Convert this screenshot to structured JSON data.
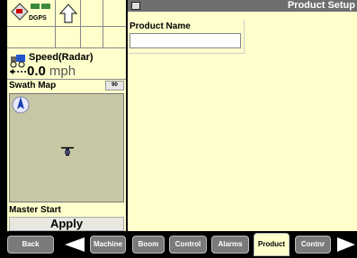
{
  "status": {
    "gps_label": "DGPS",
    "speed_label": "Speed(Radar)",
    "speed_value": "0.0",
    "speed_unit": "mph"
  },
  "swath": {
    "title": "Swath Map",
    "zoom_label": "90"
  },
  "master": {
    "label": "Master Start",
    "apply_label": "Apply"
  },
  "page": {
    "title": "Product Setup",
    "product_name_label": "Product Name",
    "product_name_value": ""
  },
  "tabs": {
    "back": "Back",
    "machine": "Machine",
    "boom": "Boom",
    "control": "Control",
    "alarms": "Alarms",
    "product": "Product",
    "controller": "Contnr"
  },
  "colors": {
    "panel_bg": "#ffffcc",
    "titlebar_bg": "#6e6e6e",
    "tab_bg": "#7a7a7a",
    "map_bg": "#c7c7a6"
  }
}
